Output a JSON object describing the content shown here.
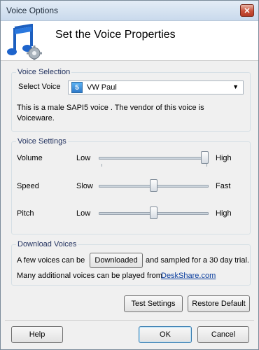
{
  "window": {
    "title": "Voice Options",
    "close_glyph": "✕"
  },
  "header": {
    "title": "Set the Voice Properties",
    "icon": "music-note-gear-icon"
  },
  "voice_selection": {
    "group_label": "Voice Selection",
    "select_label": "Select Voice",
    "selected_voice": "VW Paul",
    "sapi_badge": "5",
    "description_line1": "This is a  male SAPI5  voice . The vendor of this voice is",
    "description_line2": "Voiceware."
  },
  "voice_settings": {
    "group_label": "Voice Settings",
    "volume": {
      "label": "Volume",
      "min": "Low",
      "max": "High",
      "value": 1.0
    },
    "speed": {
      "label": "Speed",
      "min": "Slow",
      "max": "Fast",
      "value": 0.5
    },
    "pitch": {
      "label": "Pitch",
      "min": "Low",
      "max": "High",
      "value": 0.5
    }
  },
  "download": {
    "group_label": "Download Voices",
    "line1_prefix": "A few voices can be",
    "download_button": "Downloaded",
    "line1_suffix": "and sampled for a 30 day trial.",
    "line2_prefix": "Many additional voices can be played from",
    "link_text": "DeskShare.com"
  },
  "actions": {
    "test": "Test Settings",
    "restore": "Restore Default"
  },
  "footer": {
    "help": "Help",
    "ok": "OK",
    "cancel": "Cancel"
  }
}
